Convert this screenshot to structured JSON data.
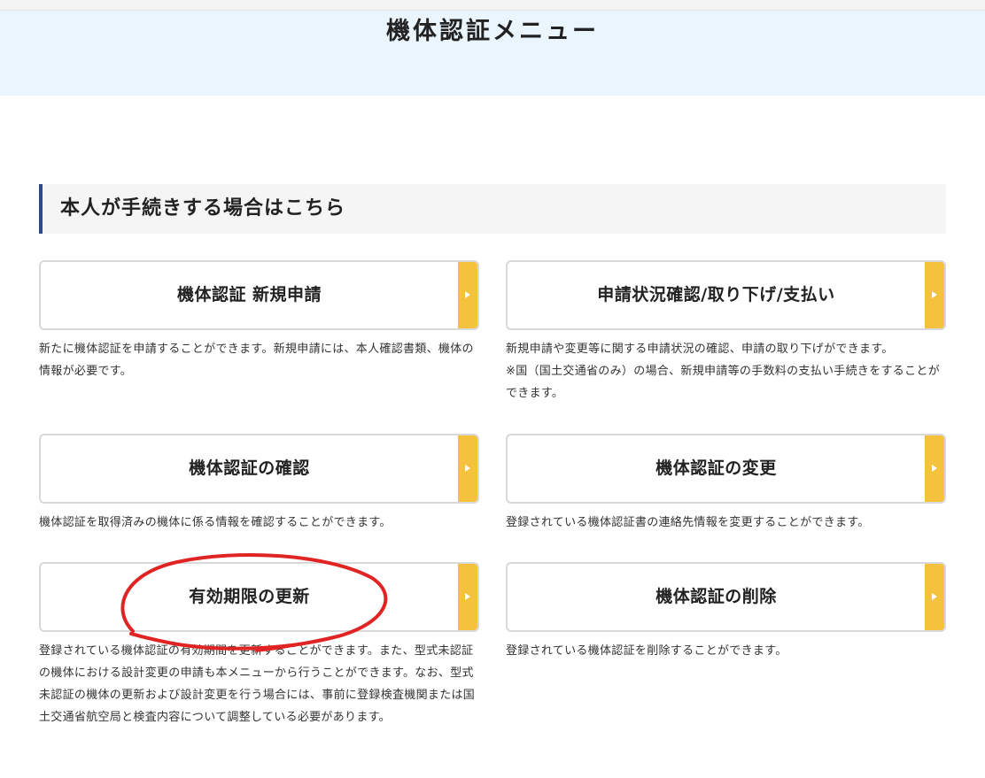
{
  "hero": {
    "title": "機体認証メニュー"
  },
  "section": {
    "heading": "本人が手続きする場合はこちら"
  },
  "cards": [
    {
      "label": "機体認証 新規申請",
      "description": [
        "新たに機体認証を申請することができます。新規申請には、本人確認書類、機体の情報が必要です。"
      ]
    },
    {
      "label": "申請状況確認/取り下げ/支払い",
      "description": [
        "新規申請や変更等に関する申請状況の確認、申請の取り下げができます。",
        "※国（国土交通省のみ）の場合、新規申請等の手数料の支払い手続きをすることができます。"
      ]
    },
    {
      "label": "機体認証の確認",
      "description": [
        "機体認証を取得済みの機体に係る情報を確認することができます。"
      ]
    },
    {
      "label": "機体認証の変更",
      "description": [
        "登録されている機体認証書の連絡先情報を変更することができます。"
      ]
    },
    {
      "label": "有効期限の更新",
      "description": [
        "登録されている機体認証の有効期間を更新することができます。また、型式未認証の機体における設計変更の申請も本メニューから行うことができます。なお、型式未認証の機体の更新および設計変更を行う場合には、事前に登録検査機関または国土交通省航空局と検査内容について調整している必要があります。"
      ]
    },
    {
      "label": "機体認証の削除",
      "description": [
        "登録されている機体認証を削除することができます。"
      ]
    }
  ],
  "colors": {
    "hero_bg": "#eaf5fd",
    "heading_bar": "#2b4a8c",
    "card_tab": "#f5c23e",
    "annotation": "#e02424"
  }
}
